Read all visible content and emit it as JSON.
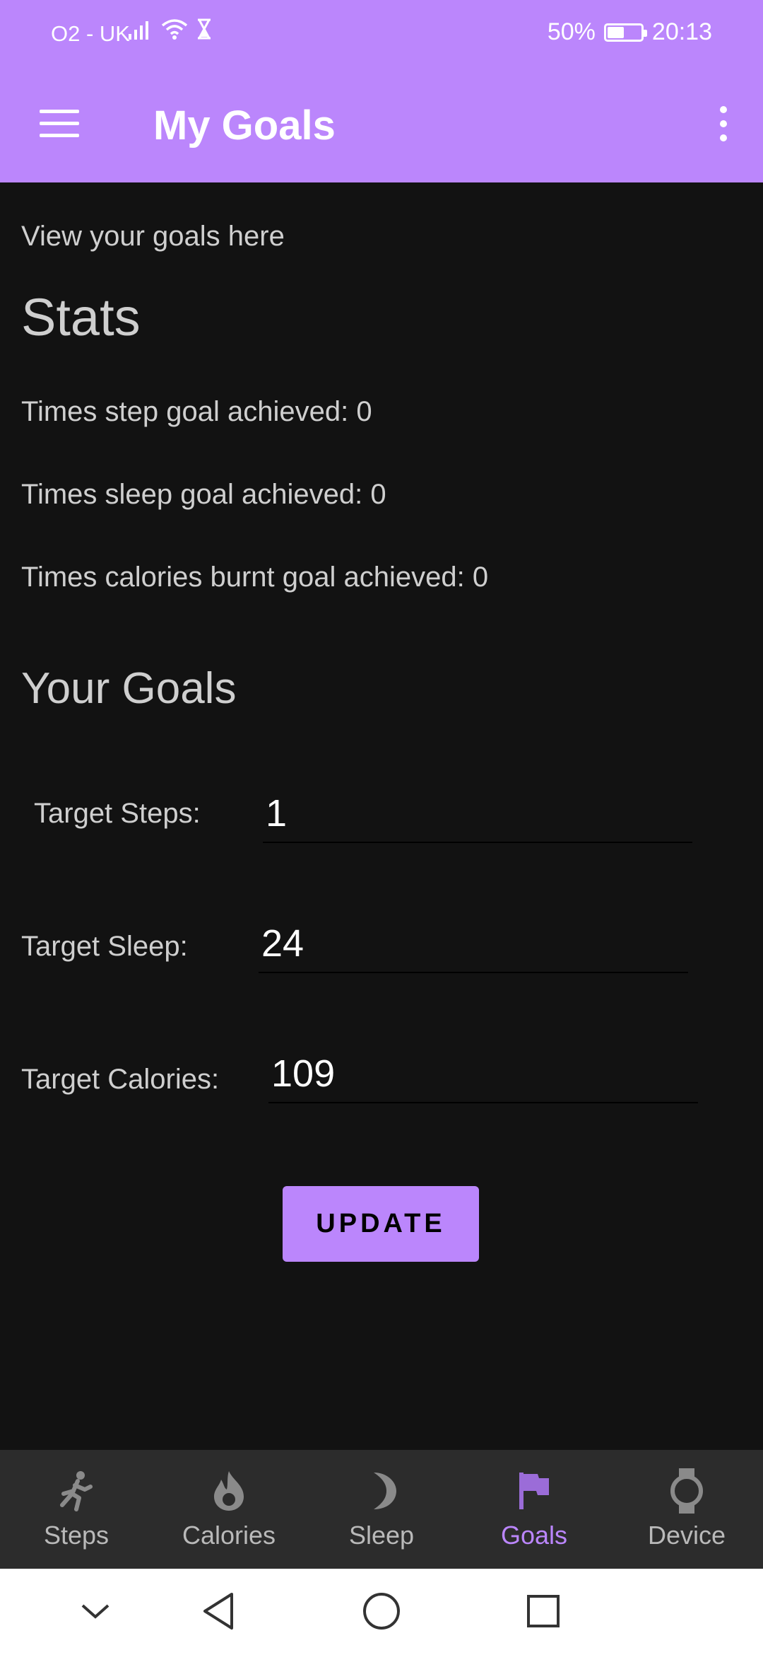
{
  "status_bar": {
    "carrier": "O2 - UK",
    "battery_percent_label": "50%",
    "battery_level": 0.5,
    "time": "20:13",
    "icons": [
      "signal-icon",
      "wifi-icon",
      "hourglass-icon",
      "battery-icon"
    ]
  },
  "app_bar": {
    "title": "My Goals",
    "menu_icon": "hamburger-menu-icon",
    "overflow_icon": "more-vert-icon",
    "color": "#bb86fc"
  },
  "content": {
    "subtitle": "View your goals here",
    "stats_heading": "Stats",
    "stats": [
      "Times step goal achieved: 0",
      "Times sleep goal achieved: 0",
      "Times calories burnt goal achieved: 0"
    ],
    "goals_heading": "Your Goals",
    "fields": [
      {
        "label": "Target Steps:",
        "value": "1"
      },
      {
        "label": "Target Sleep:",
        "value": "24"
      },
      {
        "label": "Target Calories:",
        "value": "109"
      }
    ],
    "update_button": "UPDATE"
  },
  "bottom_nav": {
    "items": [
      {
        "label": "Steps",
        "icon": "running-icon",
        "active": false
      },
      {
        "label": "Calories",
        "icon": "flame-icon",
        "active": false
      },
      {
        "label": "Sleep",
        "icon": "moon-icon",
        "active": false
      },
      {
        "label": "Goals",
        "icon": "flag-icon",
        "active": true
      },
      {
        "label": "Device",
        "icon": "watch-icon",
        "active": false
      }
    ],
    "active_color": "#bb86fc",
    "inactive_color": "#b9b9b9"
  },
  "system_nav": {
    "buttons": [
      "collapse-chevron-icon",
      "back-icon",
      "home-icon",
      "recents-icon"
    ]
  }
}
